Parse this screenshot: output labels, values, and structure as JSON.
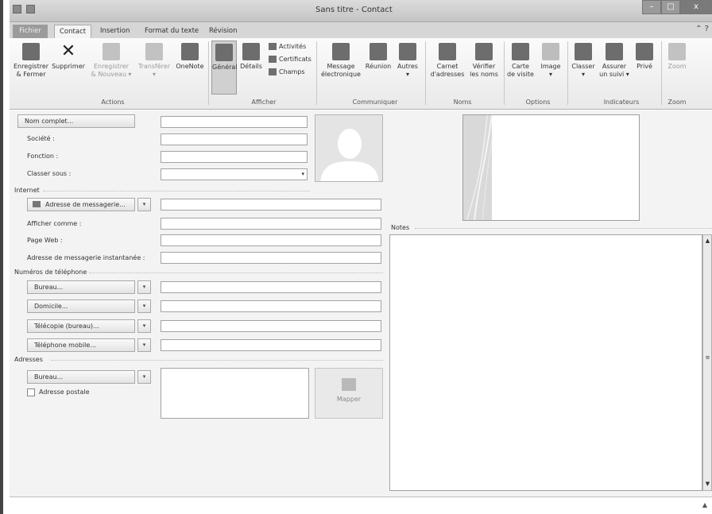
{
  "window": {
    "title": "Sans titre - Contact",
    "minimize": "–",
    "maximize": "□",
    "close": "x"
  },
  "tabs": [
    {
      "label": "Fichier"
    },
    {
      "label": "Contact"
    },
    {
      "label": "Insertion"
    },
    {
      "label": "Format du texte"
    },
    {
      "label": "Révision"
    }
  ],
  "ribbon": {
    "actions": {
      "save_close": [
        "Enregistrer",
        "& Fermer"
      ],
      "delete": "Supprimer",
      "save_new": [
        "Enregistrer",
        "& Nouveau ▾"
      ],
      "forward": [
        "Transférer",
        "▾"
      ],
      "onenote": "OneNote",
      "group": "Actions"
    },
    "show": {
      "general": "Général",
      "details": "Détails",
      "activities": "Activités",
      "certificates": "Certificats",
      "fields": "Champs",
      "group": "Afficher"
    },
    "communicate": {
      "email": [
        "Message",
        "électronique"
      ],
      "meeting": "Réunion",
      "more": [
        "Autres",
        "▾"
      ],
      "group": "Communiquer"
    },
    "names": {
      "address_book": [
        "Carnet",
        "d'adresses"
      ],
      "check_names": [
        "Vérifier",
        "les noms"
      ],
      "group": "Noms"
    },
    "options": {
      "business_card": [
        "Carte",
        "de visite"
      ],
      "picture": [
        "Image",
        "▾"
      ],
      "group": "Options"
    },
    "tags": {
      "categorize": [
        "Classer",
        "▾"
      ],
      "follow_up": [
        "Assurer",
        "un suivi ▾"
      ],
      "private": "Privé",
      "group": "Indicateurs"
    },
    "zoom": {
      "zoom": "Zoom",
      "group": "Zoom"
    }
  },
  "form": {
    "full_name_btn": "Nom complet...",
    "company": "Société :",
    "job_title": "Fonction :",
    "file_as": "Classer sous :",
    "internet_section": "Internet",
    "email_btn": "Adresse de messagerie...",
    "display_as": "Afficher comme :",
    "web_page": "Page Web :",
    "im_address": "Adresse de messagerie instantanée :",
    "phone_section": "Numéros de téléphone",
    "phones": [
      {
        "label": "Bureau..."
      },
      {
        "label": "Domicile..."
      },
      {
        "label": "Télécopie (bureau)..."
      },
      {
        "label": "Téléphone mobile..."
      }
    ],
    "address_section": "Adresses",
    "address_btn": "Bureau...",
    "mailing_address": "Adresse postale",
    "map_btn": "Mapper",
    "notes": "Notes"
  }
}
